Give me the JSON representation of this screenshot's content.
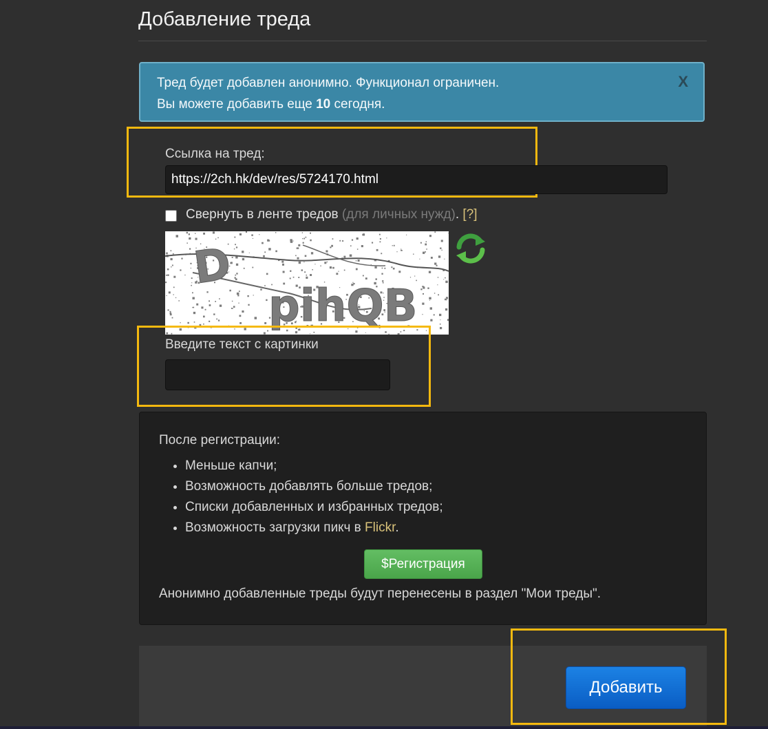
{
  "page": {
    "title": "Добавление треда"
  },
  "alert": {
    "line1": "Тред будет добавлен анонимно. Функционал ограничен.",
    "line2_prefix": "Вы можете добавить еще ",
    "line2_count": "10",
    "line2_suffix": " сегодня.",
    "close_label": "X",
    "color": "#3b87a6"
  },
  "form": {
    "url_label": "Ссылка на тред:",
    "url_value": "https://2ch.hk/dev/res/5724170.html",
    "collapse_label": "Свернуть в ленте тредов",
    "collapse_muted": "(для личных нужд)",
    "collapse_sep": ".",
    "collapse_help": "[?]",
    "collapse_checked": false,
    "captcha_text": "DpihQB",
    "captcha_label": "Введите текст с картинки",
    "captcha_value": ""
  },
  "registration": {
    "intro": "После регистрации:",
    "benefits": [
      "Меньше капчи;",
      "Возможность добавлять больше тредов;",
      "Списки добавленных и избранных тредов;"
    ],
    "benefit4_prefix": "Возможность загрузки пикч в ",
    "benefit4_link": "Flickr",
    "benefit4_suffix": ".",
    "button_label": "$Регистрация",
    "note": "Анонимно добавленные треды будут перенесены в раздел \"Мои треды\"."
  },
  "actions": {
    "submit_label": "Добавить",
    "submit_color": "#0a5dc4"
  },
  "icons": {
    "refresh": "refresh-icon",
    "close": "close-icon"
  }
}
